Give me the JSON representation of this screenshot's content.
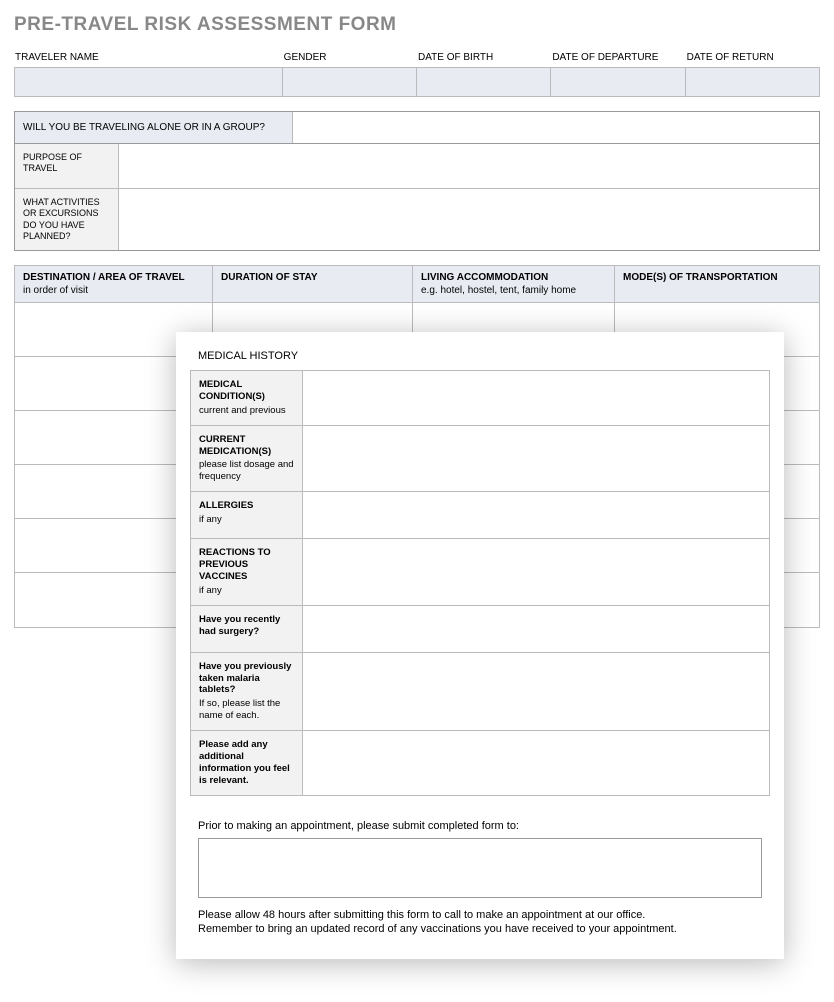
{
  "title": "PRE-TRAVEL RISK ASSESSMENT FORM",
  "top": {
    "traveler_name": "TRAVELER NAME",
    "gender": "GENDER",
    "dob": "DATE OF BIRTH",
    "departure": "DATE OF DEPARTURE",
    "return": "DATE OF RETURN"
  },
  "section2": {
    "alone_or_group": "WILL YOU BE TRAVELING ALONE OR IN A GROUP?",
    "purpose": "PURPOSE OF TRAVEL",
    "activities": "WHAT ACTIVITIES OR EXCURSIONS DO YOU HAVE PLANNED?"
  },
  "dest": {
    "h1": "DESTINATION / AREA OF TRAVEL",
    "h1_sub": "in order of visit",
    "h2": "DURATION OF STAY",
    "h3": "LIVING ACCOMMODATION",
    "h3_sub": "e.g. hotel, hostel, tent, family home",
    "h4": "MODE(S) OF TRANSPORTATION"
  },
  "overlay": {
    "title": "MEDICAL HISTORY",
    "rows": [
      {
        "b": "MEDICAL CONDITION(S)",
        "s": "current and previous"
      },
      {
        "b": "CURRENT MEDICATION(S)",
        "s": "please list dosage and frequency"
      },
      {
        "b": "ALLERGIES",
        "s": "if any"
      },
      {
        "b": "REACTIONS TO PREVIOUS VACCINES",
        "s": "if any"
      },
      {
        "b": "Have you recently had surgery?",
        "s": ""
      },
      {
        "b": "Have you previously taken malaria tablets?",
        "s": "If so, please list the name of each."
      },
      {
        "b": "Please add any additional information you feel is relevant.",
        "s": ""
      }
    ],
    "prio_label": "Prior to making an appointment, please submit completed form to:",
    "note1": "Please allow 48 hours after submitting this form to call to make an appointment at our office.",
    "note2": "Remember to bring an updated record of any vaccinations you have received to your appointment."
  }
}
